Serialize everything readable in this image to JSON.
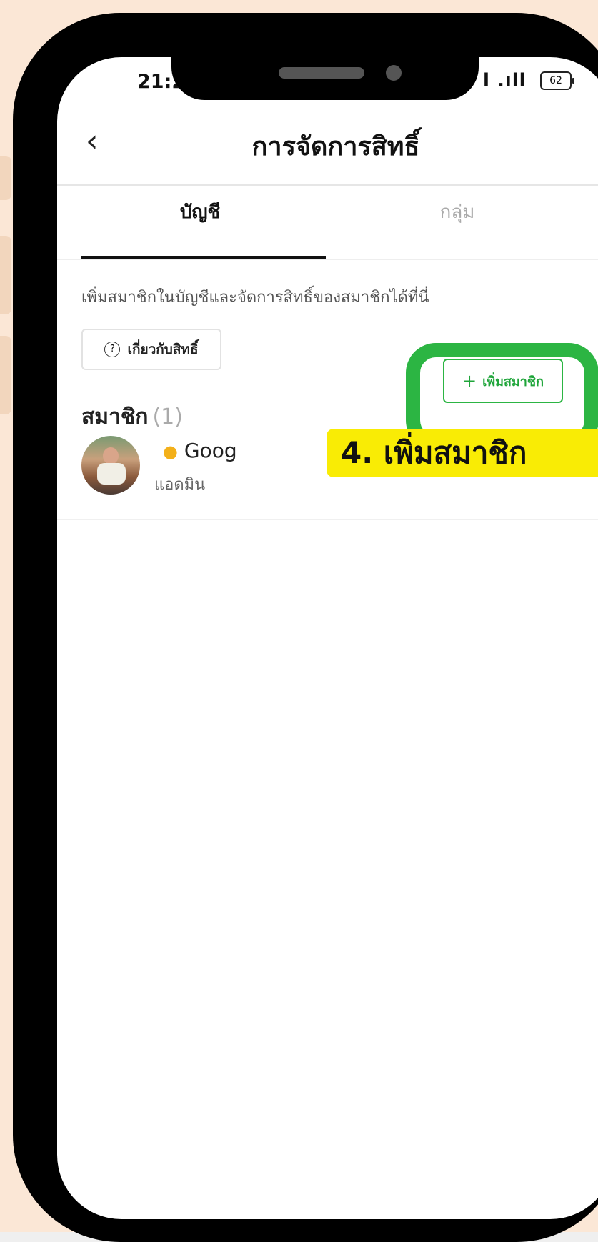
{
  "status_bar": {
    "time": "21:2",
    "signal": "l .ıll",
    "battery": "62"
  },
  "header": {
    "back_icon": "chevron-left-icon",
    "title": "การจัดการสิทธิ์"
  },
  "tabs": [
    {
      "label": "บัญชี",
      "active": true
    },
    {
      "label": "กลุ่ม",
      "active": false
    }
  ],
  "intro_text": "เพิ่มสมาชิกในบัญชีและจัดการสิทธิ์ของสมาชิกได้ที่นี่",
  "about_button": {
    "icon": "help-circle-icon",
    "label": "เกี่ยวกับสิทธิ์"
  },
  "members": {
    "heading": "สมาชิก",
    "count": "(1)",
    "add_button": {
      "plus": "+",
      "label": "เพิ่มสมาชิก"
    },
    "items": [
      {
        "name": "Goog",
        "name_icon": "duck-emoji-icon",
        "role": "แอดมิน"
      }
    ]
  },
  "annotation": {
    "text": "4. เพิ่มสมาชิก",
    "ring_color": "#2cb543",
    "label_color": "#f9ec05"
  }
}
